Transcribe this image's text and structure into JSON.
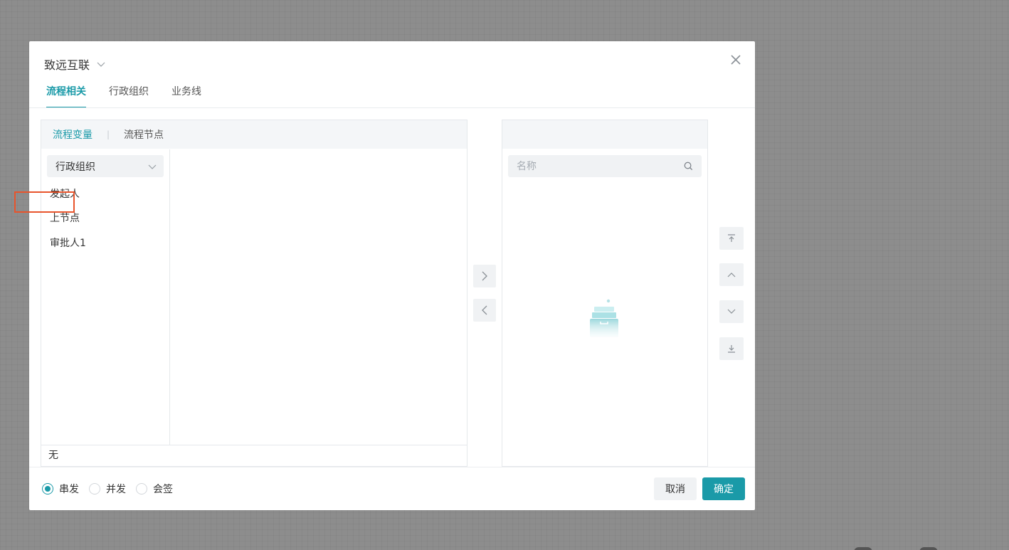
{
  "dialog": {
    "company": "致远互联",
    "tabs": [
      {
        "label": "流程相关",
        "active": true
      },
      {
        "label": "行政组织",
        "active": false
      },
      {
        "label": "业务线",
        "active": false
      }
    ],
    "sub_tabs": [
      {
        "label": "流程变量",
        "active": true
      },
      {
        "label": "流程节点",
        "active": false
      }
    ],
    "sub_tab_separator": "|",
    "org_select": {
      "value": "行政组织"
    },
    "variables": [
      {
        "label": "发起人"
      },
      {
        "label": "上节点"
      },
      {
        "label": "审批人1",
        "highlighted": true
      }
    ],
    "bottom_value": "无",
    "search": {
      "placeholder": "名称",
      "value": ""
    },
    "modes": [
      {
        "label": "串发",
        "checked": true
      },
      {
        "label": "并发",
        "checked": false
      },
      {
        "label": "会签",
        "checked": false
      }
    ],
    "buttons": {
      "cancel": "取消",
      "confirm": "确定"
    }
  },
  "colors": {
    "accent": "#1a9aa8",
    "highlight": "#e8542c"
  },
  "icons": [
    "chevron-down-icon",
    "close-icon",
    "search-icon",
    "arrow-right-icon",
    "arrow-left-icon",
    "move-top-icon",
    "move-up-icon",
    "move-down-icon",
    "move-bottom-icon",
    "empty-box-icon"
  ]
}
